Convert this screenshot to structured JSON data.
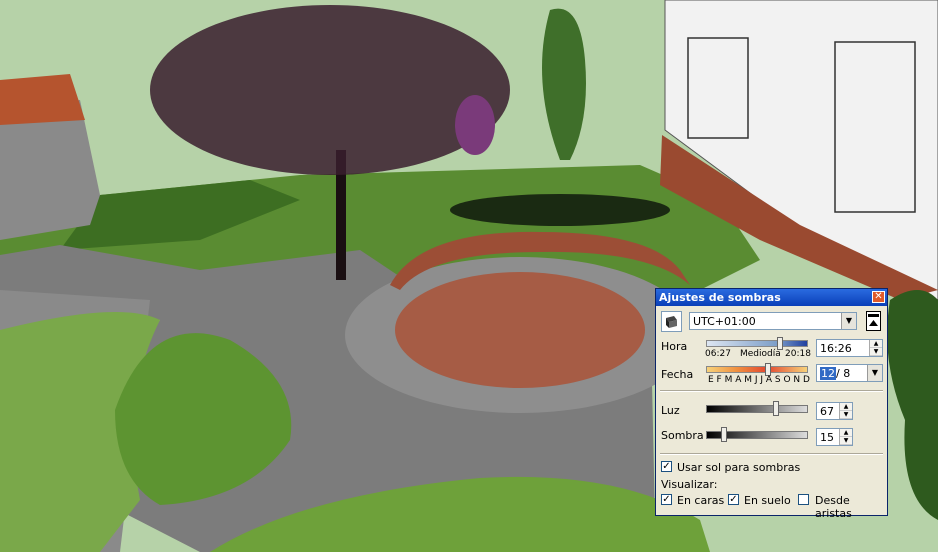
{
  "dialog": {
    "title": "Ajustes de sombras",
    "close_symbol": "✕",
    "timezone": "UTC+01:00",
    "time": {
      "label": "Hora",
      "sunrise": "06:27",
      "midday": "Mediodía",
      "sunset": "20:18",
      "value": "16:26"
    },
    "date": {
      "label": "Fecha",
      "months": "E F M A M J J A S O N D",
      "day": "12",
      "month": "/ 8"
    },
    "light": {
      "label": "Luz",
      "value": "67"
    },
    "shadow": {
      "label": "Sombra",
      "value": "15"
    },
    "use_sun_label": "Usar sol para sombras",
    "display_label": "Visualizar:",
    "on_faces_label": "En caras",
    "on_ground_label": "En suelo",
    "from_edges_label": "Desde aristas",
    "check_mark": "✓"
  },
  "icons": {
    "sun_icon": "sun-shadow-icon",
    "dropdown": "chevron-down-icon",
    "collapse": "collapse-icon"
  },
  "colors": {
    "titlebar": "#0a3fb8",
    "dialog_bg": "#ece9d8",
    "brick": "#a04a30",
    "lawn": "#6e9e3a",
    "sky": "#b6d2a8"
  }
}
